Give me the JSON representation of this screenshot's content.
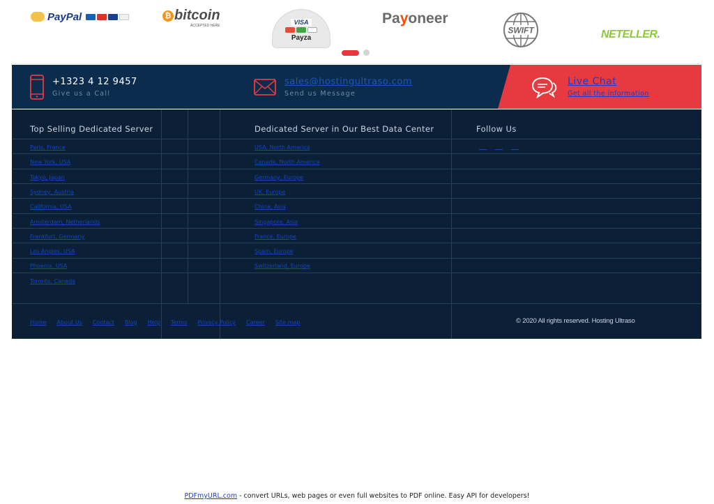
{
  "payment_logos": {
    "paypal": "PayPal",
    "bitcoin": "bitcoin",
    "bitcoin_sub": "ACCEPTED HERE",
    "payza_visa": "VISA",
    "payza": "Payza",
    "payoneer_pa": "Pa",
    "payoneer_y": "y",
    "payoneer_rest": "oneer",
    "swift": "SWIFT",
    "neteller": "NETELLER"
  },
  "contact_bar": {
    "phone": "+1323 4 12 9457",
    "phone_sub": "Give us a Call",
    "email": "sales@hostingultraso.com",
    "email_sub": "Send us Message",
    "live_chat": "Live Chat",
    "live_chat_sub": "Get all the information"
  },
  "footer": {
    "col1_title": "Top Selling Dedicated Server",
    "col2_title": "Dedicated Server in Our Best Data Center",
    "col3_title": "Follow Us",
    "col1_links": [
      "Paris, France",
      "New York, USA",
      "Tokyo, Japan",
      "Sydney, Austria",
      "California, USA",
      "Amsterdam, Netherlands",
      "Frankfurt, Germany",
      "Los Angles, USA",
      "Phoenix, USA",
      "Toronto, Canada"
    ],
    "col2_links": [
      "USA, North America",
      "Canada, North America",
      "Germany, Europe",
      "UK, Europe",
      "China, Asia",
      "Singapore, Asia",
      "France, Europe",
      "Spain, Europe",
      "Switzerland, Europe"
    ],
    "bottom_links": [
      "Home",
      "About Us",
      "Contact",
      "Blog",
      "Help",
      "Terms",
      "Privacy Policy",
      "Career",
      "Site map"
    ],
    "copyright": "© 2020 All rights reserved. Hosting Ultraso"
  },
  "pdf_note": {
    "link": "PDFmyURL.com",
    "text": " - convert URLs, web pages or even full websites to PDF online. Easy API for developers!"
  },
  "colors": {
    "bar_navy": "#0c2c4d",
    "footer_navy": "#0b1f37",
    "live_red": "#e73a40"
  }
}
